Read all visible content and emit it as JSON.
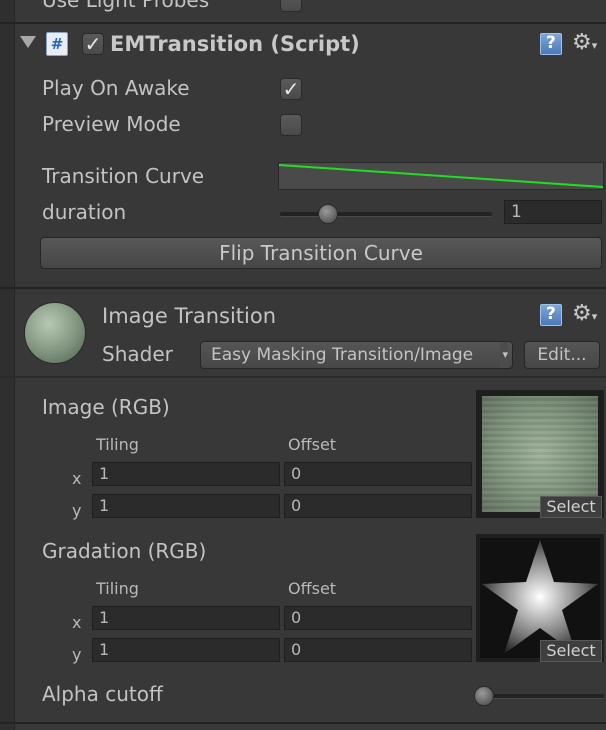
{
  "top": {
    "partial_label": "Use Light Probes"
  },
  "component1": {
    "title": "EMTransition (Script)",
    "enabled": true,
    "play_on_awake_label": "Play On Awake",
    "play_on_awake": true,
    "preview_mode_label": "Preview Mode",
    "preview_mode": false,
    "transition_curve_label": "Transition Curve",
    "duration_label": "duration",
    "duration_value": "1",
    "duration_slider_fraction": 0.2,
    "flip_button": "Flip Transition Curve"
  },
  "component2": {
    "title": "Image Transition",
    "shader_label": "Shader",
    "shader_value": "Easy Masking Transition/Image",
    "edit_button": "Edit...",
    "image_label": "Image (RGB)",
    "gradation_label": "Gradation (RGB)",
    "tiling_label": "Tiling",
    "offset_label": "Offset",
    "x_label": "x",
    "y_label": "y",
    "image": {
      "tiling_x": "1",
      "tiling_y": "1",
      "offset_x": "0",
      "offset_y": "0"
    },
    "gradation": {
      "tiling_x": "1",
      "tiling_y": "1",
      "offset_x": "0",
      "offset_y": "0"
    },
    "select_label": "Select",
    "alpha_cutoff_label": "Alpha cutoff",
    "alpha_cutoff_fraction": 0.0
  },
  "colors": {
    "curve": "#22dd22",
    "background": "#383838"
  },
  "icons": [
    "foldout-arrow-icon",
    "script-icon",
    "help-icon",
    "gear-icon",
    "material-preview-icon"
  ]
}
